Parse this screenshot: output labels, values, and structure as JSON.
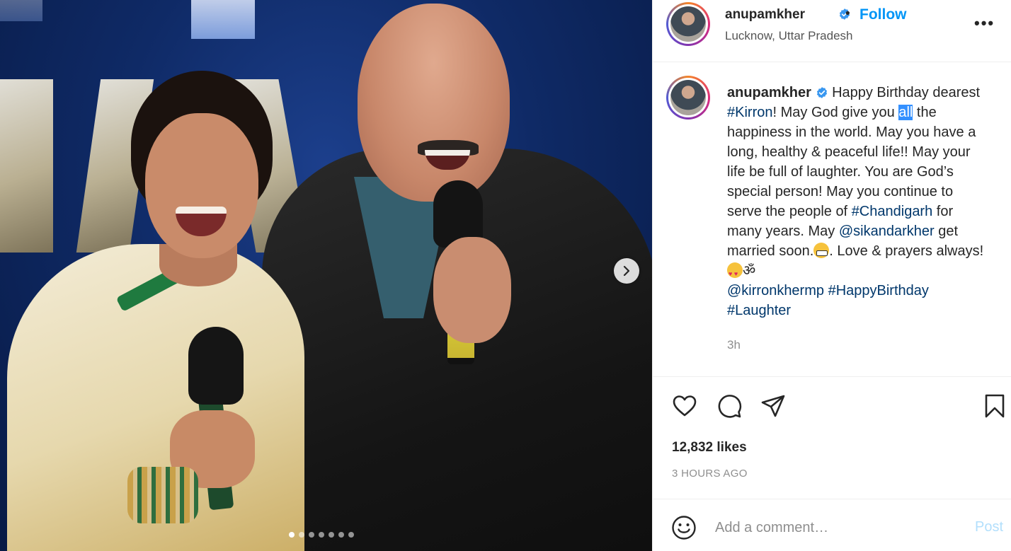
{
  "post": {
    "username": "anupamkher",
    "follow_label": "Follow",
    "separator": "•",
    "location": "Lucknow, Uttar Pradesh",
    "more_label": "•••"
  },
  "caption": {
    "username": "anupamkher",
    "t1": "Happy Birthday dearest ",
    "tag_kirron": "#Kirron",
    "t2": "! May God give you ",
    "t_selected": "all",
    "t3": " the happiness in the world. May you have a long, healthy & peaceful life!! May your life be full of laughter. You are God’s special person! May you continue to serve the people of ",
    "tag_chandigarh": "#Chandigarh",
    "t4": " for many years. May ",
    "mention_sikandar": "@sikandarkher",
    "t5": " get married soon.",
    "t6": ". Love & prayers always!",
    "om": "ॐ",
    "mention_kirron": "@kirronkhermp",
    "tag_happybirthday": "#HappyBirthday",
    "tag_laughter": "#Laughter",
    "time": "3h"
  },
  "stats": {
    "likes": "12,832 likes",
    "posted_ago": "3 HOURS AGO"
  },
  "comment": {
    "placeholder": "Add a comment…",
    "post_label": "Post"
  },
  "carousel": {
    "total_slides": 7,
    "active_index": 0
  },
  "icons": {
    "header": [
      "verified-badge-icon",
      "more-options-icon"
    ],
    "actions": [
      "heart-icon",
      "comment-icon",
      "share-icon",
      "bookmark-icon"
    ],
    "comment": [
      "emoji-icon"
    ],
    "media": [
      "chevron-right-icon"
    ]
  },
  "colors": {
    "link": "#0095f6",
    "hashtag": "#00376b",
    "muted": "#8e8e8e",
    "post_disabled": "#b2dffc",
    "selection": "#3390ff"
  }
}
